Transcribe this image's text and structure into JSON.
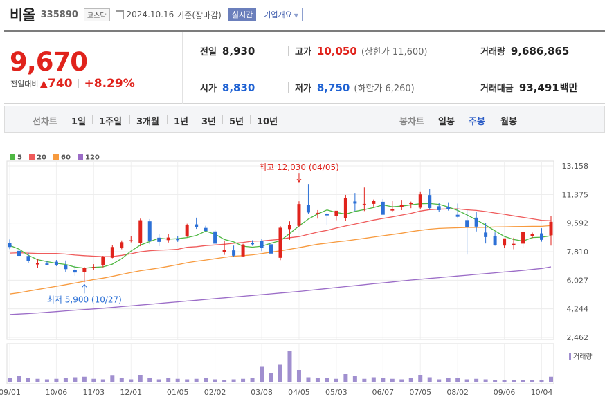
{
  "header": {
    "name": "비올",
    "code": "335890",
    "market": "코스닥",
    "date": "2024.10.16",
    "basis": "기준(장마감)",
    "realtime_label": "실시간",
    "company_label": "기업개요"
  },
  "quote": {
    "price": "9,670",
    "change_label": "전일대비",
    "change_arrow": "▲",
    "change_abs": "740",
    "change_pct": "+8.29%",
    "prev_close_label": "전일",
    "prev_close": "8,930",
    "high_label": "고가",
    "high": "10,050",
    "upper_limit": "(상한가 11,600)",
    "volume_label": "거래량",
    "volume": "9,686,865",
    "open_label": "시가",
    "open": "8,830",
    "low_label": "저가",
    "low": "8,750",
    "lower_limit": "(하한가 6,260)",
    "amount_label": "거래대금",
    "amount": "93,491",
    "amount_unit": "백만"
  },
  "period_bar": {
    "line_label": "선차트",
    "line_options": [
      "1일",
      "1주일",
      "3개월",
      "1년",
      "3년",
      "5년",
      "10년"
    ],
    "candle_label": "봉차트",
    "candle_options": [
      "일봉",
      "주봉",
      "월봉"
    ],
    "candle_active": "주봉"
  },
  "chart_data": {
    "type": "candlestick",
    "legend": [
      {
        "name": "5",
        "color": "#4fb843"
      },
      {
        "name": "20",
        "color": "#ef5b5b"
      },
      {
        "name": "60",
        "color": "#f79a3e"
      },
      {
        "name": "120",
        "color": "#9b6cc7"
      }
    ],
    "y_ticks": [
      "13,158",
      "11,375",
      "9,592",
      "7,810",
      "6,027",
      "4,244",
      "2,462"
    ],
    "ylim": [
      2462,
      13158
    ],
    "x_labels": [
      "09/01",
      "10/06",
      "11/03",
      "12/01",
      "01/05",
      "02/02",
      "03/08",
      "04/05",
      "05/03",
      "06/07",
      "07/05",
      "08/02",
      "09/06",
      "10/04"
    ],
    "x_label_index": [
      0,
      5,
      9,
      13,
      18,
      22,
      27,
      31,
      35,
      40,
      44,
      48,
      53,
      57
    ],
    "max_annotation": {
      "text": "최고 12,030 (04/05)",
      "index": 31,
      "value": 12030
    },
    "min_annotation": {
      "text": "최저 5,900 (10/27)",
      "index": 8,
      "value": 5900
    },
    "volume_legend": "거래량",
    "candles": [
      [
        8330,
        8570,
        7970,
        8100
      ],
      [
        7860,
        8060,
        7470,
        7550
      ],
      [
        7540,
        7740,
        7080,
        7210
      ],
      [
        7010,
        7380,
        6780,
        7120
      ],
      [
        7070,
        7240,
        6980,
        6990
      ],
      [
        7180,
        7290,
        6910,
        6960
      ],
      [
        6990,
        7260,
        6520,
        6720
      ],
      [
        6680,
        6980,
        6310,
        6510
      ],
      [
        6520,
        6850,
        5900,
        6800
      ],
      [
        6850,
        7030,
        6650,
        6850
      ],
      [
        6950,
        7550,
        6830,
        7510
      ],
      [
        7430,
        8210,
        7400,
        8100
      ],
      [
        8060,
        8510,
        7960,
        8400
      ],
      [
        8510,
        8800,
        8390,
        8520
      ],
      [
        8330,
        9870,
        8150,
        9770
      ],
      [
        9700,
        9840,
        8280,
        8480
      ],
      [
        8680,
        8930,
        8160,
        8420
      ],
      [
        8530,
        8900,
        8380,
        8690
      ],
      [
        8630,
        8800,
        8420,
        8530
      ],
      [
        8800,
        9550,
        8720,
        9470
      ],
      [
        9510,
        9930,
        9230,
        9350
      ],
      [
        9290,
        9420,
        9090,
        9100
      ],
      [
        9070,
        9190,
        8410,
        8310
      ],
      [
        7770,
        8460,
        7610,
        7940
      ],
      [
        7890,
        8190,
        7500,
        7560
      ],
      [
        7520,
        8300,
        7490,
        8250
      ],
      [
        8330,
        8520,
        8180,
        8270
      ],
      [
        8470,
        8600,
        7840,
        8030
      ],
      [
        8270,
        8500,
        7670,
        7690
      ],
      [
        7430,
        9400,
        7280,
        9300
      ],
      [
        9220,
        9700,
        8550,
        9450
      ],
      [
        9420,
        10950,
        9320,
        10780
      ],
      [
        10730,
        12030,
        10150,
        10250
      ],
      [
        10200,
        10400,
        9870,
        10230
      ],
      [
        10160,
        10230,
        9490,
        10070
      ],
      [
        10040,
        10330,
        9770,
        10360
      ],
      [
        9880,
        11350,
        9730,
        11140
      ],
      [
        10940,
        11470,
        10340,
        10810
      ],
      [
        10780,
        11810,
        10340,
        10790
      ],
      [
        10790,
        11060,
        10620,
        10970
      ],
      [
        10920,
        11090,
        10110,
        10110
      ],
      [
        10370,
        10960,
        10290,
        10450
      ],
      [
        10580,
        11040,
        10400,
        10710
      ],
      [
        10780,
        10930,
        10520,
        10850
      ],
      [
        10550,
        11570,
        10460,
        11380
      ],
      [
        11340,
        11730,
        10420,
        10530
      ],
      [
        10640,
        10830,
        10290,
        10400
      ],
      [
        10580,
        10890,
        10370,
        10450
      ],
      [
        10110,
        10810,
        9940,
        9980
      ],
      [
        9780,
        10420,
        7630,
        9350
      ],
      [
        9930,
        10300,
        9070,
        9370
      ],
      [
        9000,
        9600,
        8320,
        8720
      ],
      [
        8790,
        9010,
        8180,
        8220
      ],
      [
        8190,
        8510,
        8060,
        8640
      ],
      [
        8230,
        8680,
        7960,
        8300
      ],
      [
        8310,
        9070,
        8020,
        9020
      ],
      [
        8790,
        9000,
        8650,
        8930
      ],
      [
        8950,
        9270,
        8430,
        8550
      ],
      [
        8830,
        10050,
        8190,
        9670
      ]
    ],
    "ma5": [
      8200,
      7970,
      7580,
      7310,
      7190,
      7080,
      7010,
      6850,
      6780,
      6830,
      6860,
      7030,
      7380,
      7850,
      8220,
      8440,
      8650,
      8590,
      8620,
      8690,
      8820,
      9090,
      8900,
      8570,
      8420,
      8150,
      8090,
      8150,
      8340,
      8490,
      8940,
      9410,
      9840,
      10160,
      10410,
      10250,
      10150,
      10320,
      10430,
      10560,
      10720,
      10610,
      10650,
      10730,
      10800,
      10810,
      10760,
      10590,
      10380,
      10100,
      9800,
      9460,
      9110,
      8760,
      8570,
      8470,
      8690,
      8710,
      8800
    ],
    "ma20": [
      7720,
      7740,
      7720,
      7700,
      7700,
      7700,
      7660,
      7600,
      7560,
      7530,
      7500,
      7510,
      7580,
      7680,
      7800,
      7870,
      7900,
      7920,
      7960,
      8080,
      8120,
      8190,
      8230,
      8270,
      8330,
      8390,
      8460,
      8480,
      8530,
      8580,
      8680,
      8750,
      8890,
      9030,
      9140,
      9280,
      9410,
      9530,
      9650,
      9780,
      9880,
      9980,
      10090,
      10200,
      10340,
      10430,
      10460,
      10470,
      10480,
      10420,
      10380,
      10310,
      10220,
      10140,
      10040,
      9950,
      9860,
      9770,
      9740
    ],
    "ma60": [
      5170,
      5250,
      5350,
      5450,
      5550,
      5650,
      5750,
      5850,
      5960,
      6070,
      6160,
      6270,
      6390,
      6510,
      6620,
      6700,
      6790,
      6890,
      7000,
      7120,
      7210,
      7290,
      7370,
      7460,
      7530,
      7560,
      7610,
      7690,
      7780,
      7860,
      7960,
      8060,
      8170,
      8270,
      8340,
      8420,
      8480,
      8560,
      8640,
      8720,
      8800,
      8880,
      8960,
      9060,
      9140,
      9210,
      9260,
      9280,
      9300,
      9320,
      9320,
      9330,
      9350,
      9360,
      9370,
      9380,
      9390,
      9390,
      9430
    ],
    "ma120": [
      3890,
      3920,
      3950,
      3990,
      4030,
      4070,
      4120,
      4160,
      4200,
      4240,
      4280,
      4330,
      4380,
      4430,
      4480,
      4530,
      4580,
      4630,
      4680,
      4730,
      4780,
      4830,
      4880,
      4930,
      4980,
      5030,
      5080,
      5130,
      5180,
      5230,
      5280,
      5330,
      5390,
      5450,
      5510,
      5570,
      5630,
      5690,
      5750,
      5810,
      5860,
      5920,
      5980,
      6040,
      6090,
      6140,
      6190,
      6240,
      6290,
      6340,
      6390,
      6440,
      6490,
      6540,
      6590,
      6640,
      6700,
      6760,
      6860
    ],
    "volume": [
      45,
      60,
      40,
      35,
      30,
      35,
      40,
      50,
      55,
      35,
      30,
      65,
      40,
      30,
      70,
      45,
      30,
      40,
      35,
      30,
      35,
      40,
      30,
      25,
      30,
      35,
      45,
      150,
      90,
      170,
      300,
      120,
      50,
      40,
      45,
      35,
      80,
      60,
      35,
      50,
      40,
      35,
      30,
      40,
      70,
      50,
      30,
      45,
      40,
      30,
      35,
      30,
      25,
      25,
      20,
      25,
      25,
      20,
      55
    ]
  }
}
